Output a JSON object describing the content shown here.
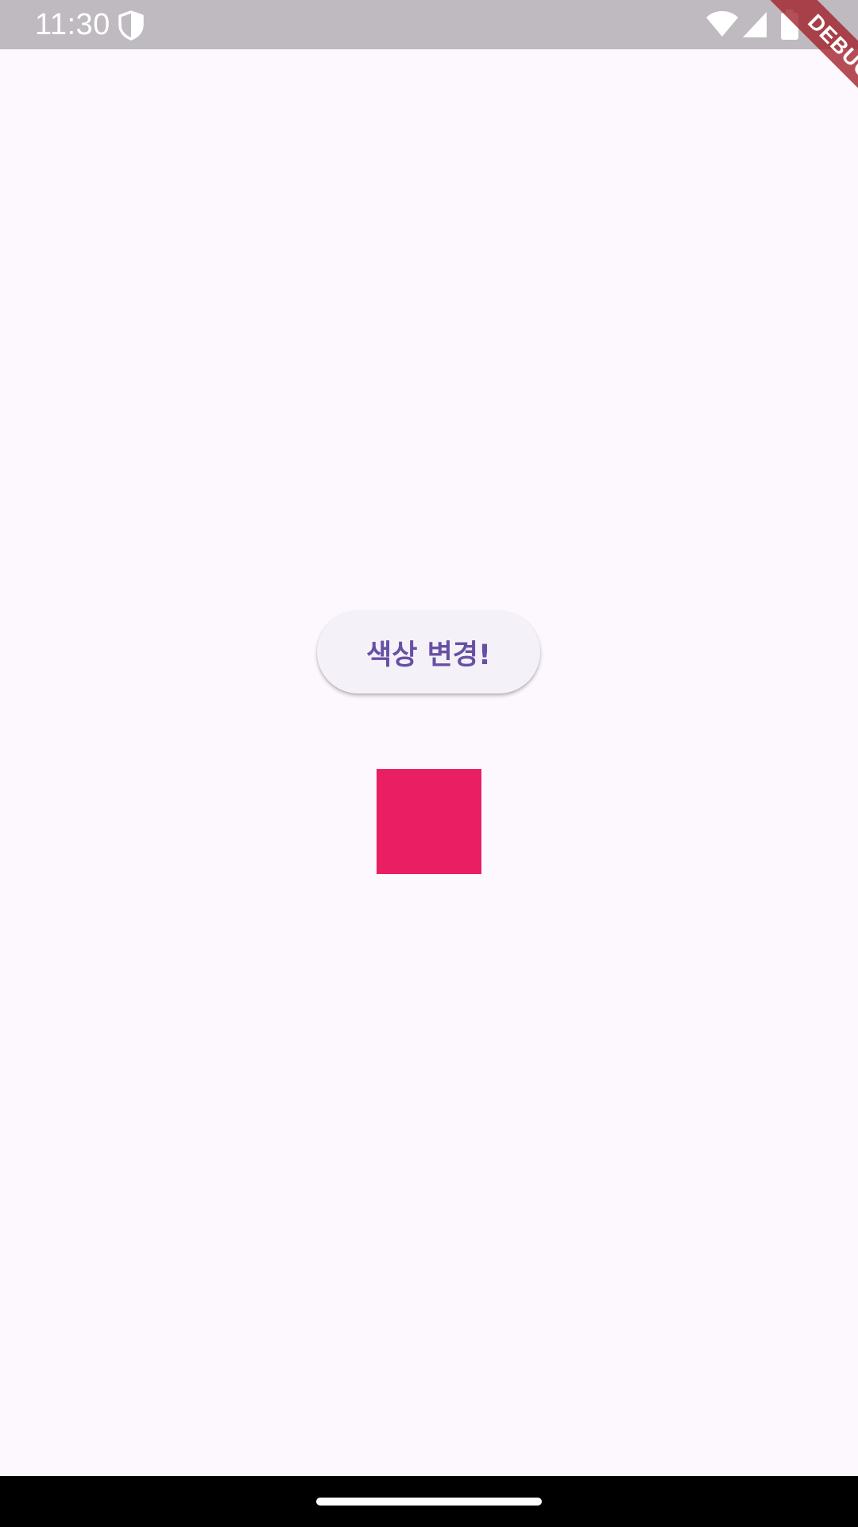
{
  "status_bar": {
    "time": "11:30",
    "icons": [
      "shield-icon",
      "wifi-icon",
      "signal-icon",
      "battery-icon"
    ]
  },
  "debug_banner": {
    "label": "DEBUG"
  },
  "main": {
    "button_label": "색상 변경!",
    "box_color": "#e91e63"
  },
  "theme": {
    "background": "#fdf7fe",
    "status_bar_background": "#bfbac0",
    "accent": "#6750a4",
    "button_background": "#f5f1f8"
  },
  "nav_bar": {
    "icons": [
      "home-handle-icon"
    ]
  }
}
